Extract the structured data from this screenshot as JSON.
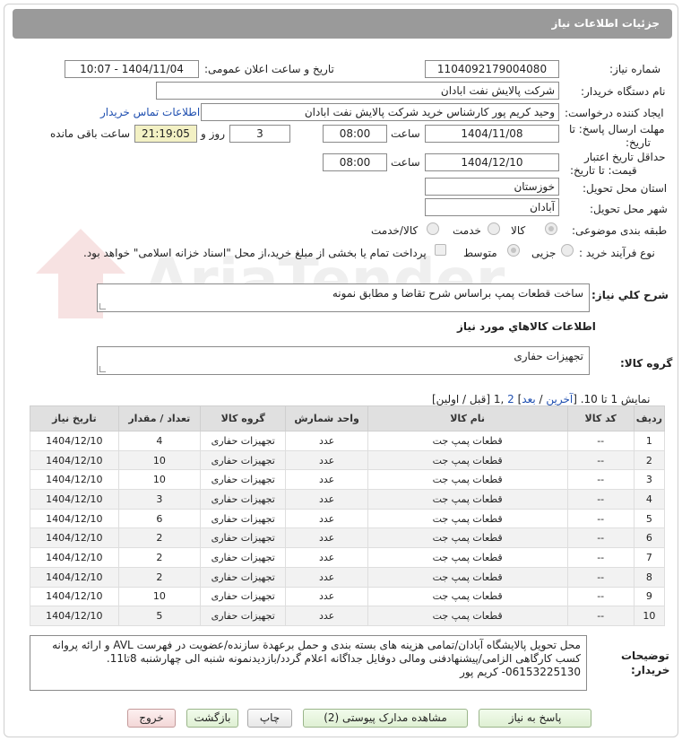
{
  "header": {
    "title": "جزئیات اطلاعات نیاز"
  },
  "form": {
    "need_number": {
      "label": "شماره نیاز:",
      "value": "1104092179004080"
    },
    "announce": {
      "label": "تاریخ و ساعت اعلان عمومی:",
      "value": "1404/11/04 - 10:07"
    },
    "buyer_org": {
      "label": "نام دستگاه خریدار:",
      "value": "شرکت پالایش نفت ابادان"
    },
    "creator": {
      "label": "ایجاد کننده درخواست:",
      "value": "وحید کریم پور کارشناس خرید  شرکت پالایش نفت ابادان",
      "contact_link": "اطلاعات تماس خریدار"
    },
    "deadline": {
      "label_line1": "مهلت ارسال پاسخ: تا",
      "label_line2": "تاریخ:",
      "date": "1404/11/08",
      "time_label": "ساعت",
      "time": "08:00",
      "days": "3",
      "days_label": "روز و",
      "remaining": "21:19:05",
      "remaining_label": "ساعت باقی مانده"
    },
    "validity": {
      "label_line1": "حداقل تاریخ اعتبار",
      "label_line2": "قیمت: تا تاریخ:",
      "date": "1404/12/10",
      "time_label": "ساعت",
      "time": "08:00"
    },
    "province": {
      "label": "استان محل تحویل:",
      "value": "خوزستان"
    },
    "city": {
      "label": "شهر محل تحویل:",
      "value": "آبادان"
    },
    "category": {
      "label": "طبقه بندی موضوعی:",
      "options": [
        "کالا",
        "خدمت",
        "کالا/خدمت"
      ]
    },
    "process": {
      "label": "نوع فرآیند خرید :",
      "options": [
        "جزیی",
        "متوسط"
      ],
      "note": "پرداخت تمام یا بخشی از مبلغ خرید،از محل \"اسناد خزانه اسلامی\" خواهد بود."
    }
  },
  "summary": {
    "label": "شرح کلي نياز:",
    "value": "ساخت قطعات پمپ براساس شرح تقاضا و مطابق نمونه"
  },
  "goods_section": {
    "title": "اطلاعات کالاهاي مورد نياز"
  },
  "goods_group": {
    "label": "گروه کالا:",
    "value": "تجهیزات حفاری"
  },
  "pager": {
    "prefix": "نمایش 1 تا 10. [",
    "last": "آخرین",
    "sep": " / ",
    "next": "بعد",
    "mid": "] ",
    "page2": "2",
    "suffix": " ,1 [قبل / اولین]"
  },
  "table": {
    "headers": [
      "ردیف",
      "کد کالا",
      "نام کالا",
      "واحد شمارش",
      "گروه کالا",
      "تعداد / مقدار",
      "تاریخ نیاز"
    ],
    "rows": [
      [
        "1",
        "--",
        "قطعات پمپ جت",
        "عدد",
        "تجهیزات حفاری",
        "4",
        "1404/12/10"
      ],
      [
        "2",
        "--",
        "قطعات پمپ جت",
        "عدد",
        "تجهیزات حفاری",
        "10",
        "1404/12/10"
      ],
      [
        "3",
        "--",
        "قطعات پمپ جت",
        "عدد",
        "تجهیزات حفاری",
        "10",
        "1404/12/10"
      ],
      [
        "4",
        "--",
        "قطعات پمپ جت",
        "عدد",
        "تجهیزات حفاری",
        "3",
        "1404/12/10"
      ],
      [
        "5",
        "--",
        "قطعات پمپ جت",
        "عدد",
        "تجهیزات حفاری",
        "6",
        "1404/12/10"
      ],
      [
        "6",
        "--",
        "قطعات پمپ جت",
        "عدد",
        "تجهیزات حفاری",
        "2",
        "1404/12/10"
      ],
      [
        "7",
        "--",
        "قطعات پمپ جت",
        "عدد",
        "تجهیزات حفاری",
        "2",
        "1404/12/10"
      ],
      [
        "8",
        "--",
        "قطعات پمپ جت",
        "عدد",
        "تجهیزات حفاری",
        "2",
        "1404/12/10"
      ],
      [
        "9",
        "--",
        "قطعات پمپ جت",
        "عدد",
        "تجهیزات حفاری",
        "10",
        "1404/12/10"
      ],
      [
        "10",
        "--",
        "قطعات پمپ جت",
        "عدد",
        "تجهیزات حفاری",
        "5",
        "1404/12/10"
      ]
    ]
  },
  "buyer_notes": {
    "label_line1": "توضیحات",
    "label_line2": "خریدار:",
    "value": "محل تحویل پالایشگاه آبادان/تمامی هزینه های بسته بندی و حمل برعهدة سازنده/عضویت در فهرست AVL و ارائه پروانه کسب کارگاهی الزامی/پیشنهادفنی ومالی دوفایل جداگانه اعلام گردد/بازدیدنمونه شنبه الی چهارشنبه 8تا11. 06153225130- کریم پور"
  },
  "buttons": {
    "reply": "پاسخ به نیاز",
    "docs": "مشاهده مدارک پیوستی (2)",
    "print": "چاپ",
    "back": "بازگشت",
    "exit": "خروج"
  },
  "watermark_text": "AriaTender.neT"
}
